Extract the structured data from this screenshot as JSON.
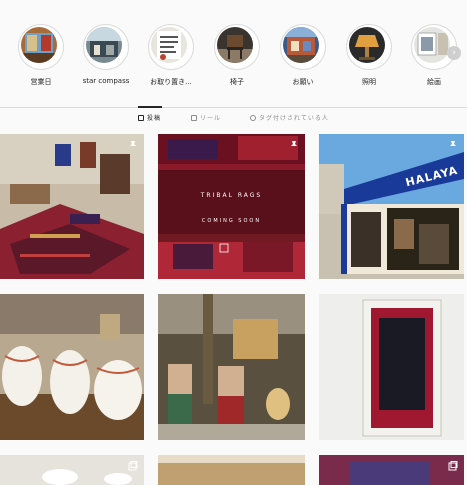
{
  "stories": [
    {
      "label": "営業日",
      "icon": "story-thumb-shop"
    },
    {
      "label": "star compass",
      "icon": "story-thumb-compass"
    },
    {
      "label": "お取り置き...",
      "icon": "story-thumb-hold"
    },
    {
      "label": "椅子",
      "icon": "story-thumb-chair"
    },
    {
      "label": "お願い",
      "icon": "story-thumb-request"
    },
    {
      "label": "照明",
      "icon": "story-thumb-lamp"
    },
    {
      "label": "絵画",
      "icon": "story-thumb-painting"
    }
  ],
  "tabs": [
    {
      "label": "投稿",
      "icon": "grid-icon"
    },
    {
      "label": "リール",
      "icon": "reel-icon"
    },
    {
      "label": "タグ付けされている人",
      "icon": "tag-icon"
    }
  ],
  "posts": {
    "post2_line1": "TRIBAL RAGS",
    "post2_line2": "COMING SOON",
    "post3_sign": "HALAYA"
  },
  "colors": {
    "background": "#fafafa",
    "text": "#262626",
    "muted": "#8e8e8e",
    "divider": "#dbdbdb"
  }
}
